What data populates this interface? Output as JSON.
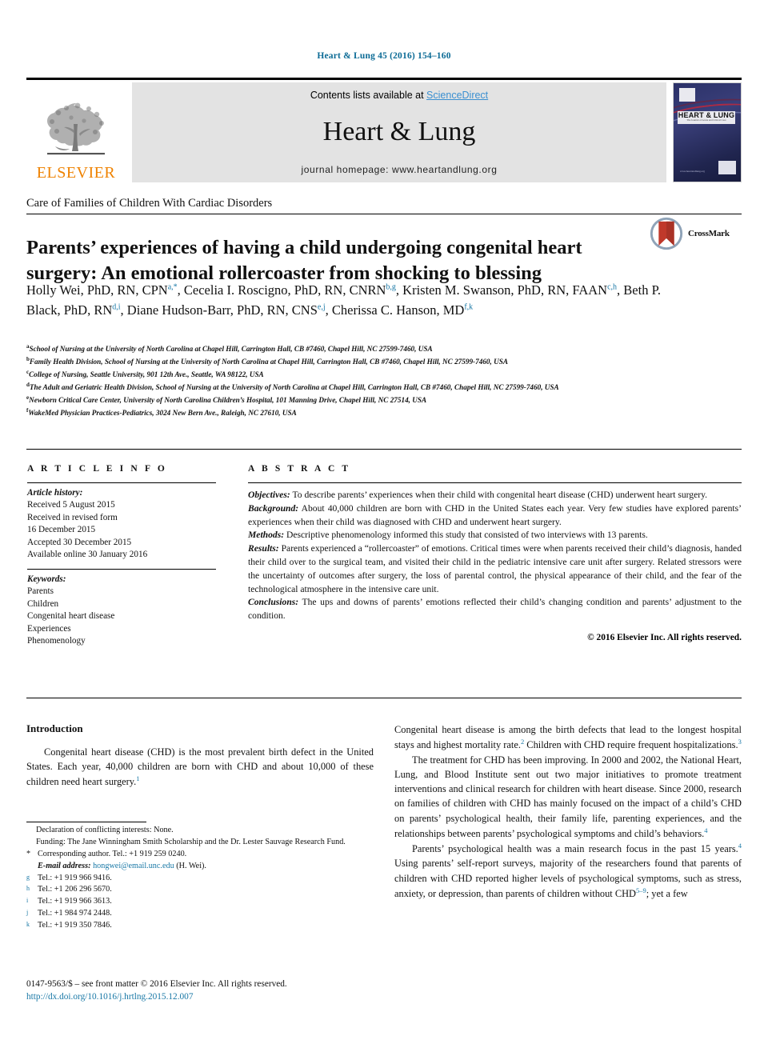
{
  "running_head": "Heart & Lung 45 (2016) 154–160",
  "masthead": {
    "publisher_name": "ELSEVIER",
    "contents_prefix": "Contents lists available at ",
    "sciencedirect": "ScienceDirect",
    "journal_name": "Heart & Lung",
    "homepage_line": "journal homepage: www.heartandlung.org",
    "cover": {
      "title_main": "HEART & LUNG",
      "title_sub": "The Journal of Acute and Critical Care",
      "url": "www.heartandlung.org"
    }
  },
  "section_label": "Care of Families of Children With Cardiac Disorders",
  "title": "Parents’ experiences of having a child undergoing congenital heart surgery: An emotional rollercoaster from shocking to blessing",
  "crossmark": {
    "label": "CrossMark"
  },
  "authors": [
    {
      "name": "Holly Wei, PhD, RN, CPN",
      "marks": "a,*",
      "sep": ", "
    },
    {
      "name": "Cecelia I. Roscigno, PhD, RN, CNRN",
      "marks": "b,g",
      "sep": ","
    },
    {
      "name": "Kristen M. Swanson, PhD, RN, FAAN",
      "marks": "c,h",
      "sep": ", "
    },
    {
      "name": "Beth P. Black, PhD, RN",
      "marks": "d,i",
      "sep": ","
    },
    {
      "name": "Diane Hudson-Barr, PhD, RN, CNS",
      "marks": "e,j",
      "sep": ", "
    },
    {
      "name": "Cherissa C. Hanson, MD",
      "marks": "f,k",
      "sep": ""
    }
  ],
  "affiliations": [
    {
      "mark": "a",
      "text": "School of Nursing at the University of North Carolina at Chapel Hill, Carrington Hall, CB #7460, Chapel Hill, NC 27599-7460, USA"
    },
    {
      "mark": "b",
      "text": "Family Health Division, School of Nursing at the University of North Carolina at Chapel Hill, Carrington Hall, CB #7460, Chapel Hill, NC 27599-7460, USA"
    },
    {
      "mark": "c",
      "text": "College of Nursing, Seattle University, 901 12th Ave., Seattle, WA 98122, USA"
    },
    {
      "mark": "d",
      "text": "The Adult and Geriatric Health Division, School of Nursing at the University of North Carolina at Chapel Hill, Carrington Hall, CB #7460, Chapel Hill, NC 27599-7460, USA"
    },
    {
      "mark": "e",
      "text": "Newborn Critical Care Center, University of North Carolina Children’s Hospital, 101 Manning Drive, Chapel Hill, NC 27514, USA"
    },
    {
      "mark": "f",
      "text": "WakeMed Physician Practices-Pediatrics, 3024 New Bern Ave., Raleigh, NC 27610, USA"
    }
  ],
  "article_info": {
    "heading": "A R T I C L E   I N F O",
    "history_label": "Article history:",
    "history": [
      "Received 5 August 2015",
      "Received in revised form",
      "16 December 2015",
      "Accepted 30 December 2015",
      "Available online 30 January 2016"
    ],
    "keywords_label": "Keywords:",
    "keywords": [
      "Parents",
      "Children",
      "Congenital heart disease",
      "Experiences",
      "Phenomenology"
    ]
  },
  "abstract": {
    "heading": "A B S T R A C T",
    "sections": [
      {
        "label": "Objectives:",
        "text": " To describe parents’ experiences when their child with congenital heart disease (CHD) underwent heart surgery."
      },
      {
        "label": "Background:",
        "text": " About 40,000 children are born with CHD in the United States each year. Very few studies have explored parents’ experiences when their child was diagnosed with CHD and underwent heart surgery."
      },
      {
        "label": "Methods:",
        "text": " Descriptive phenomenology informed this study that consisted of two interviews with 13 parents."
      },
      {
        "label": "Results:",
        "text": " Parents experienced a “rollercoaster” of emotions. Critical times were when parents received their child’s diagnosis, handed their child over to the surgical team, and visited their child in the pediatric intensive care unit after surgery. Related stressors were the uncertainty of outcomes after surgery, the loss of parental control, the physical appearance of their child, and the fear of the technological atmosphere in the intensive care unit."
      },
      {
        "label": "Conclusions:",
        "text": " The ups and downs of parents’ emotions reflected their child’s changing condition and parents’ adjustment to the condition."
      }
    ],
    "copyright": "© 2016 Elsevier Inc. All rights reserved."
  },
  "body": {
    "intro_heading": "Introduction",
    "left_paragraphs": [
      "Congenital heart disease (CHD) is the most prevalent birth defect in the United States. Each year, 40,000 children are born with CHD and about 10,000 of these children need heart surgery."
    ],
    "left_paragraph_refs": [
      "1"
    ],
    "right_paragraphs": [
      {
        "indent": false,
        "parts": [
          {
            "t": "Congenital heart disease is among the birth defects that lead to the longest hospital stays and highest mortality rate."
          },
          {
            "sup": "2"
          },
          {
            "t": " Children with CHD require frequent hospitalizations."
          },
          {
            "sup": "3"
          }
        ]
      },
      {
        "indent": true,
        "parts": [
          {
            "t": "The treatment for CHD has been improving. In 2000 and 2002, the National Heart, Lung, and Blood Institute sent out two major initiatives to promote treatment interventions and clinical research for children with heart disease. Since 2000, research on families of children with CHD has mainly focused on the impact of a child’s CHD on parents’ psychological health, their family life, parenting experiences, and the relationships between parents’ psychological symptoms and child’s behaviors."
          },
          {
            "sup": "4"
          }
        ]
      },
      {
        "indent": true,
        "parts": [
          {
            "t": "Parents’ psychological health was a main research focus in the past 15 years."
          },
          {
            "sup": "4"
          },
          {
            "t": " Using parents’ self-report surveys, majority of the researchers found that parents of children with CHD reported higher levels of psychological symptoms, such as stress, anxiety, or depression, than parents of children without CHD"
          },
          {
            "sup": "5–9"
          },
          {
            "t": "; yet a few"
          }
        ]
      }
    ]
  },
  "footnotes": {
    "declaration": "Declaration of conflicting interests: None.",
    "funding": "Funding: The Jane Winningham Smith Scholarship and the Dr. Lester Sauvage Research Fund.",
    "corresponding": "Corresponding author. Tel.: +1 919 259 0240.",
    "corresponding_mark": "*",
    "email_label": "E-mail address:",
    "email": "hongwei@email.unc.edu",
    "email_suffix": " (H. Wei).",
    "tels": [
      {
        "mark": "g",
        "text": "Tel.: +1 919 966 9416."
      },
      {
        "mark": "h",
        "text": "Tel.: +1 206 296 5670."
      },
      {
        "mark": "i",
        "text": "Tel.: +1 919 966 3613."
      },
      {
        "mark": "j",
        "text": "Tel.: +1 984 974 2448."
      },
      {
        "mark": "k",
        "text": "Tel.: +1 919 350 7846."
      }
    ]
  },
  "page_footer": {
    "front_matter": "0147-9563/$ – see front matter © 2016 Elsevier Inc. All rights reserved.",
    "doi": "http://dx.doi.org/10.1016/j.hrtlng.2015.12.007"
  },
  "colors": {
    "link": "#1978a6",
    "sciencedirect": "#3a8fd0",
    "elsevier_orange": "#ef8200",
    "band_gray": "#e3e3e3"
  }
}
